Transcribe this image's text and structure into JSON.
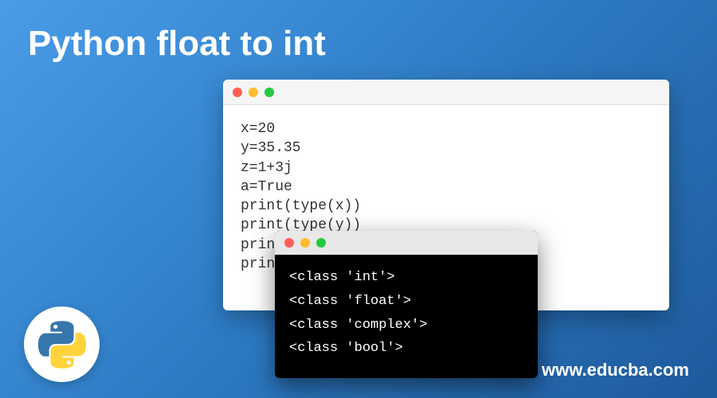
{
  "title": "Python float to int",
  "code_window": {
    "lines": [
      "x=20",
      "y=35.35",
      "z=1+3j",
      "a=True",
      "print(type(x))",
      "print(type(y))",
      "print(type(z))",
      "print(type(a))"
    ]
  },
  "terminal_window": {
    "lines": [
      "<class 'int'>",
      "<class 'float'>",
      "<class 'complex'>",
      "<class 'bool'>"
    ]
  },
  "website": "www.educba.com",
  "logo": {
    "name": "python-logo"
  }
}
